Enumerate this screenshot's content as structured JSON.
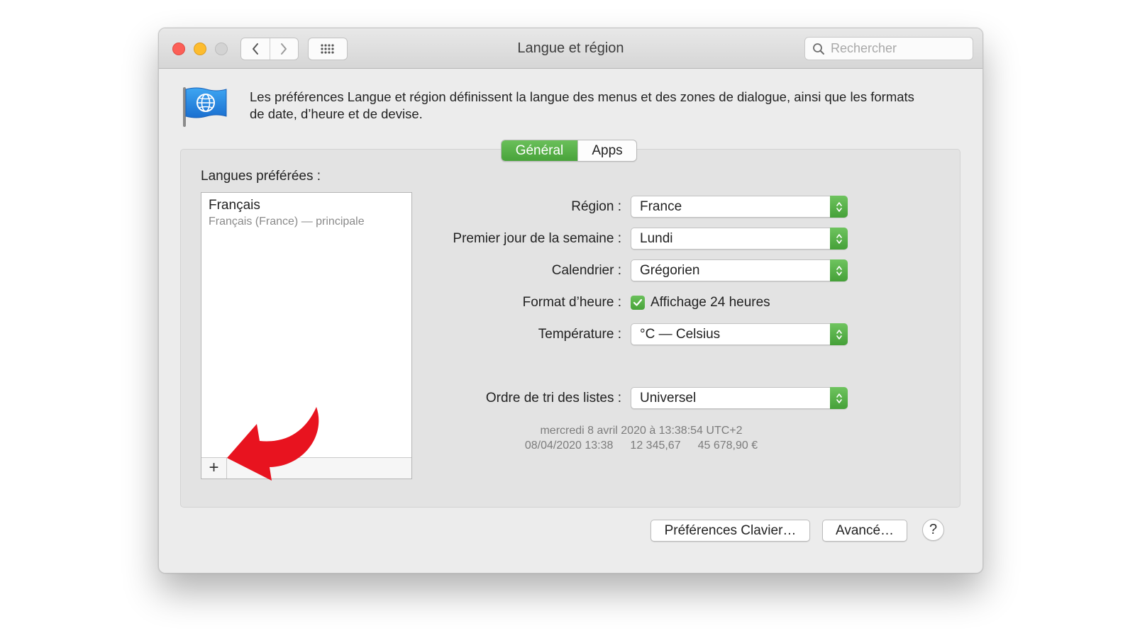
{
  "window": {
    "title": "Langue et région",
    "search_placeholder": "Rechercher"
  },
  "intro": {
    "text": "Les préférences Langue et région définissent la langue des menus et des zones de dialogue, ainsi que les formats de date, d’heure et de devise."
  },
  "tabs": [
    {
      "label": "Général",
      "active": true
    },
    {
      "label": "Apps",
      "active": false
    }
  ],
  "languages": {
    "label": "Langues préférées :",
    "items": [
      {
        "name": "Français",
        "detail": "Français (France) — principale"
      }
    ],
    "add_label": "+"
  },
  "settings": {
    "region": {
      "label": "Région :",
      "value": "France"
    },
    "first_day": {
      "label": "Premier jour de la semaine :",
      "value": "Lundi"
    },
    "calendar": {
      "label": "Calendrier :",
      "value": "Grégorien"
    },
    "time_format": {
      "label": "Format d’heure :",
      "checkbox_label": "Affichage 24 heures",
      "checked": true
    },
    "temperature": {
      "label": "Température :",
      "value": "°C — Celsius"
    },
    "sort_order": {
      "label": "Ordre de tri des listes :",
      "value": "Universel"
    }
  },
  "sample": {
    "date_long": "mercredi 8 avril 2020 à 13:38:54 UTC+2",
    "date_short": "08/04/2020 13:38",
    "number": "12 345,67",
    "currency": "45 678,90 €"
  },
  "buttons": {
    "keyboard": "Préférences Clavier…",
    "advanced": "Avancé…",
    "help": "?"
  },
  "colors": {
    "accent_green": "#48a33a",
    "annotation_red": "#e8131f"
  },
  "icons": {
    "back": "chevron-left-icon",
    "forward": "chevron-right-icon",
    "grid": "grid-icon",
    "search": "magnifier-icon",
    "flag": "globe-flag-icon",
    "annotation": "curved-arrow-icon"
  }
}
